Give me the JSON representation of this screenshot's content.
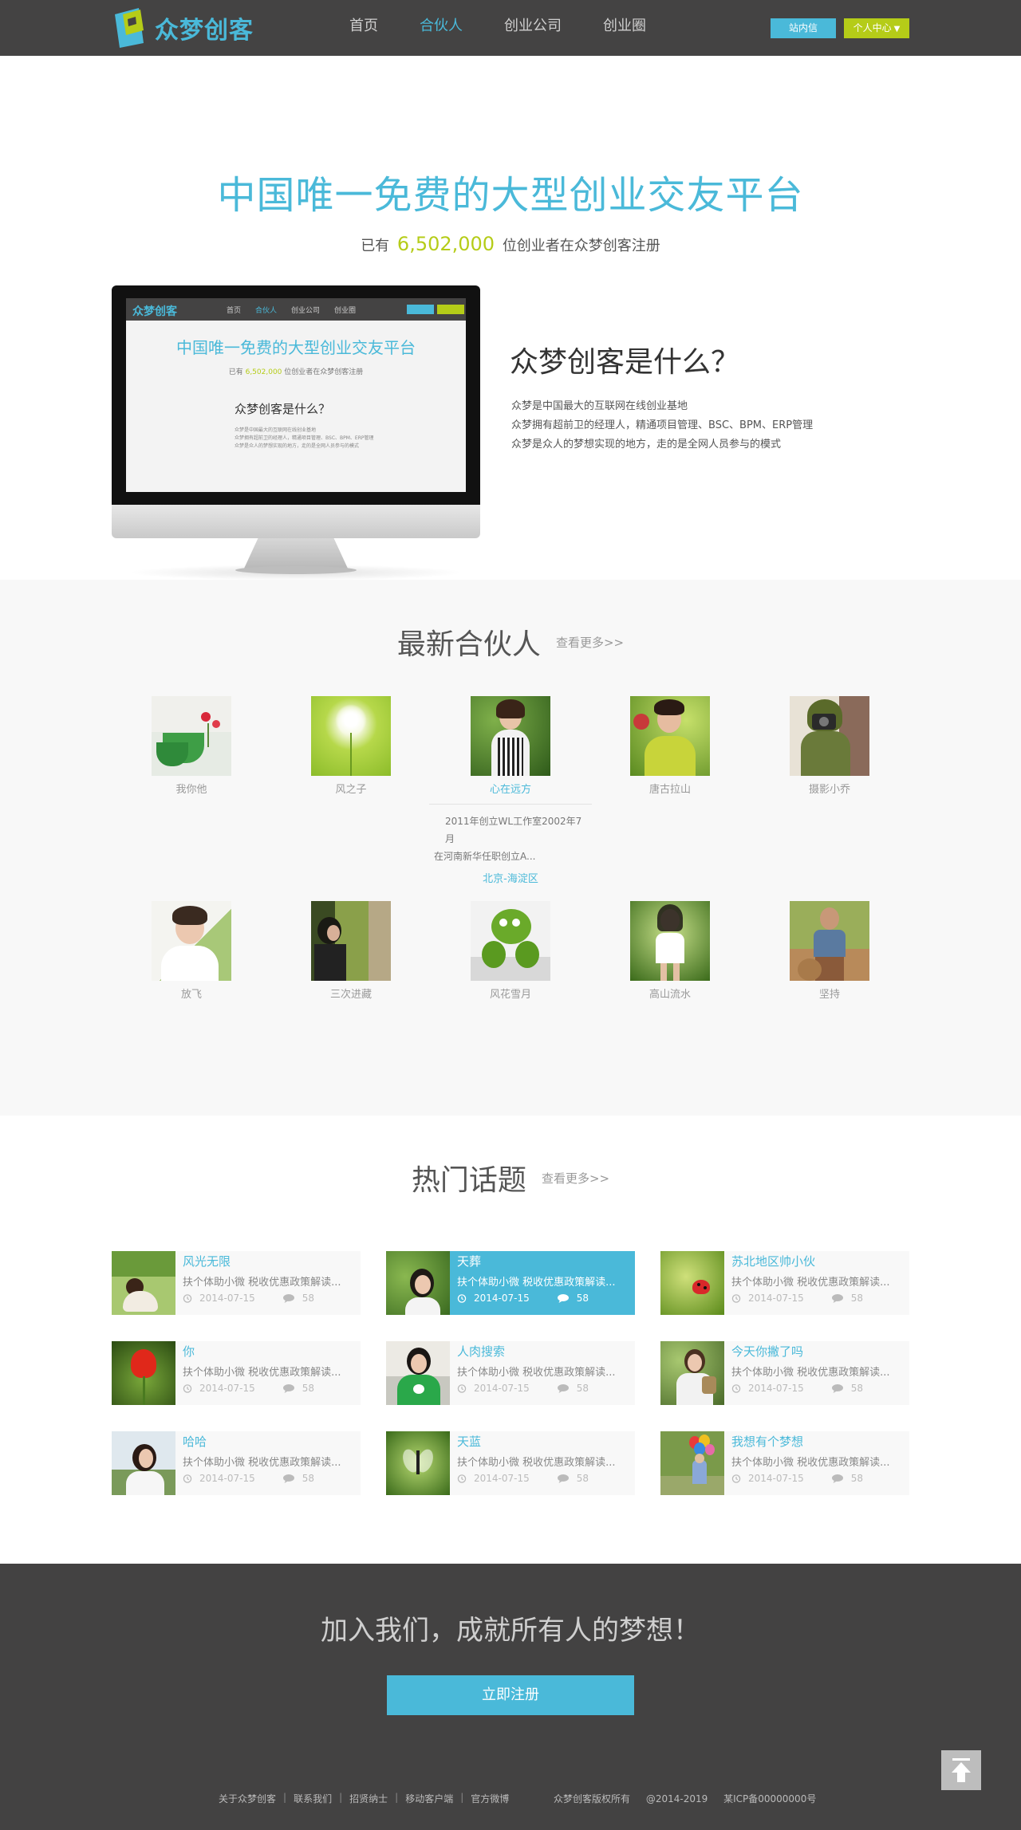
{
  "header": {
    "logo_text": "众梦创客",
    "nav": [
      {
        "label": "首页"
      },
      {
        "label": "合伙人"
      },
      {
        "label": "创业公司"
      },
      {
        "label": "创业圈"
      }
    ],
    "active_nav": "合伙人",
    "msg_button": "站内信",
    "user_button": "个人中心",
    "accent_color": "#4ab9d9",
    "secondary_color": "#b5cc18"
  },
  "banner": {
    "title": "中国唯一免费的大型创业交友平台",
    "sub_prefix": "已有",
    "count": "6,502,000",
    "sub_suffix": "位创业者在众梦创客注册",
    "what_title": "众梦创客是什么？",
    "what_lines": [
      "众梦是中国最大的互联网在线创业基地",
      "众梦拥有超前卫的经理人，精通项目管理、BSC、BPM、ERP管理",
      "众梦是众人的梦想实现的地方，走的是全网人员参与的模式"
    ],
    "carousel_active_index": 1
  },
  "partners": {
    "title": "最新合伙人",
    "more": "查看更多>>",
    "row1": [
      {
        "name": "我你他",
        "photo": "teacups-flowers"
      },
      {
        "name": "风之子",
        "photo": "dandelion"
      },
      {
        "name": "心在远方",
        "photo": "girl-in-garden"
      },
      {
        "name": "唐古拉山",
        "photo": "young-man"
      },
      {
        "name": "摄影小乔",
        "photo": "camera-girl"
      }
    ],
    "active_name": "心在远方",
    "detail": {
      "desc_line1": "2011年创立WL工作室2002年7月",
      "desc_line2": "在河南新华任职创立A...",
      "location": "北京-海淀区"
    },
    "row2": [
      {
        "name": "放飞",
        "photo": "young-man-white"
      },
      {
        "name": "三次进藏",
        "photo": "girl-tree"
      },
      {
        "name": "风花雪月",
        "photo": "green-toy"
      },
      {
        "name": "高山流水",
        "photo": "girl-forest"
      },
      {
        "name": "坚持",
        "photo": "man-field"
      }
    ]
  },
  "topics": {
    "title": "热门话题",
    "more": "查看更多>>",
    "items": [
      {
        "title": "风光无限",
        "excerpt": "扶个体助小微 税收优惠政策解读...",
        "date": "2014-07-15",
        "comments": "58",
        "photo": "girl-lawn"
      },
      {
        "title": "天葬",
        "excerpt": "扶个体助小微 税收优惠政策解读...",
        "date": "2014-07-15",
        "comments": "58",
        "photo": "girl-leaves"
      },
      {
        "title": "苏北地区帅小伙",
        "excerpt": "扶个体助小微 税收优惠政策解读...",
        "date": "2014-07-15",
        "comments": "58",
        "photo": "ladybug"
      },
      {
        "title": "你",
        "excerpt": "扶个体助小微 税收优惠政策解读...",
        "date": "2014-07-15",
        "comments": "58",
        "photo": "red-flower"
      },
      {
        "title": "人肉搜索",
        "excerpt": "扶个体助小微 税收优惠政策解读...",
        "date": "2014-07-15",
        "comments": "58",
        "photo": "boy-green-shirt"
      },
      {
        "title": "今天你撇了吗",
        "excerpt": "扶个体助小微 税收优惠政策解读...",
        "date": "2014-07-15",
        "comments": "58",
        "photo": "girl-bag"
      },
      {
        "title": "哈哈",
        "excerpt": "扶个体助小微 税收优惠政策解读...",
        "date": "2014-07-15",
        "comments": "58",
        "photo": "girl-sky"
      },
      {
        "title": "天蓝",
        "excerpt": "扶个体助小微 税收优惠政策解读...",
        "date": "2014-07-15",
        "comments": "58",
        "photo": "butterfly"
      },
      {
        "title": "我想有个梦想",
        "excerpt": "扶个体助小微 税收优惠政策解读...",
        "date": "2014-07-15",
        "comments": "58",
        "photo": "balloons"
      }
    ],
    "active_index": 1
  },
  "footer": {
    "join_title": "加入我们，成就所有人的梦想！",
    "register_button": "立即注册",
    "links": [
      {
        "label": "关于众梦创客"
      },
      {
        "label": "联系我们"
      },
      {
        "label": "招贤纳士"
      },
      {
        "label": "移动客户端"
      },
      {
        "label": "官方微博"
      }
    ],
    "rights": "众梦创客版权所有",
    "copyright": "@2014-2019",
    "icp": "某ICP备00000000号"
  }
}
